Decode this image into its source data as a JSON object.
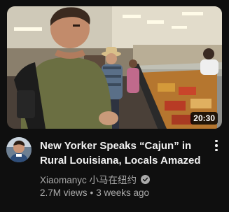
{
  "video": {
    "duration": "20:30",
    "title": "New Yorker Speaks “Cajun” in Rural Louisiana, Locals Amazed",
    "channel": "Xiaomanyc 小马在纽约",
    "views": "2.7M views",
    "separator": "•",
    "age": "3 weeks ago"
  },
  "icons": {
    "verified": "verified-check-icon",
    "menu": "more-vert-icon"
  }
}
